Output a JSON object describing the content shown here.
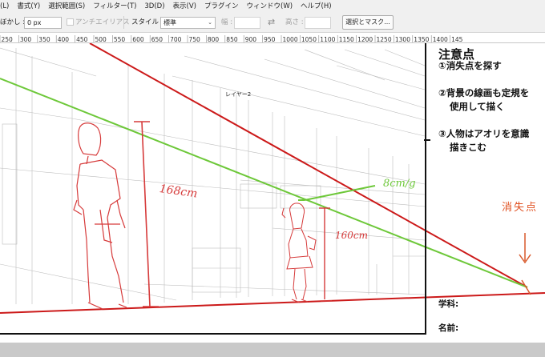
{
  "menubar": {
    "items": [
      "(L)",
      "書式(Y)",
      "選択範囲(S)",
      "フィルター(T)",
      "3D(D)",
      "表示(V)",
      "プラグイン",
      "ウィンドウ(W)",
      "ヘルプ(H)"
    ]
  },
  "options": {
    "feather_label": "ぼかし :",
    "feather_value": "0 px",
    "antialias_label": "アンチエイリアス",
    "style_label": "スタイル :",
    "style_value": "標準",
    "width_label": "幅 :",
    "height_label": "高さ :",
    "select_mask_label": "選択とマスク..."
  },
  "ruler": {
    "ticks": [
      "250",
      "300",
      "350",
      "400",
      "450",
      "500",
      "550",
      "600",
      "650",
      "700",
      "750",
      "800",
      "850",
      "900",
      "950",
      "1000",
      "1050",
      "1100",
      "1150",
      "1200",
      "1250",
      "1300",
      "1350",
      "1400",
      "145"
    ]
  },
  "canvas": {
    "layer_name": "レイヤー2",
    "notes_heading": "注意点",
    "notes": [
      "①消失点を探す",
      "②背景の線画も定規を",
      "使用して描く",
      "③人物はアオリを意識",
      "描きこむ"
    ],
    "form_class_label": "学科:",
    "form_name_label": "名前:",
    "handwritten": {
      "boy_height": "168cm",
      "girl_height": "160cm",
      "difference": "8cm/g",
      "vanishing_point": "消失点"
    },
    "colors": {
      "red_line": "#d01818",
      "green_line": "#6ec83a",
      "sketch": "#d63a3a",
      "annotation": "#e05020"
    }
  }
}
